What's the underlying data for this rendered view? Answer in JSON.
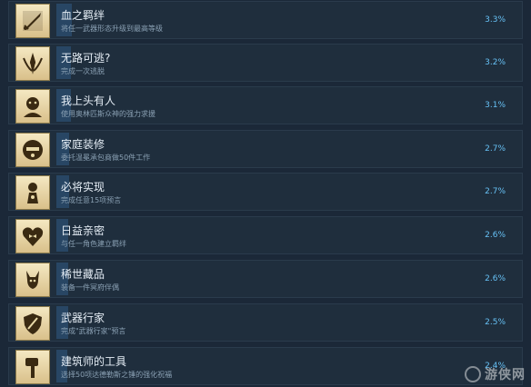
{
  "achievements": [
    {
      "title": "血之羁绊",
      "description": "将任一武器形态升级到最高等级",
      "percent": "3.3%",
      "fill": 0.033,
      "icon": "sword-icon"
    },
    {
      "title": "无路可逃?",
      "description": "完成一次逃脱",
      "percent": "3.2%",
      "fill": 0.032,
      "icon": "laurel-crest-icon"
    },
    {
      "title": "我上头有人",
      "description": "使用奥林匹斯众神的强力求援",
      "percent": "3.1%",
      "fill": 0.031,
      "icon": "god-portrait-icon"
    },
    {
      "title": "家庭装修",
      "description": "委托温冕承包商做50件工作",
      "percent": "2.7%",
      "fill": 0.027,
      "icon": "contractor-icon"
    },
    {
      "title": "必将实现",
      "description": "完成任意15项预言",
      "percent": "2.7%",
      "fill": 0.027,
      "icon": "fates-statue-icon"
    },
    {
      "title": "日益亲密",
      "description": "与任一角色建立羁绊",
      "percent": "2.6%",
      "fill": 0.026,
      "icon": "heart-bow-icon"
    },
    {
      "title": "稀世藏品",
      "description": "装备一件冥府伴偶",
      "percent": "2.6%",
      "fill": 0.026,
      "icon": "companion-icon"
    },
    {
      "title": "武器行家",
      "description": "完成\"武器行家\"预言",
      "percent": "2.5%",
      "fill": 0.025,
      "icon": "shield-weapons-icon"
    },
    {
      "title": "建筑师的工具",
      "description": "选择50项达德勒斯之锤的强化祝福",
      "percent": "2.4%",
      "fill": 0.024,
      "icon": "hammer-icon"
    }
  ],
  "watermark": {
    "text": "游侠网"
  },
  "colors": {
    "background": "#1b2838",
    "row": "#1f2e3d",
    "accent": "#66c0f4",
    "bar": "#2a4a6b"
  }
}
